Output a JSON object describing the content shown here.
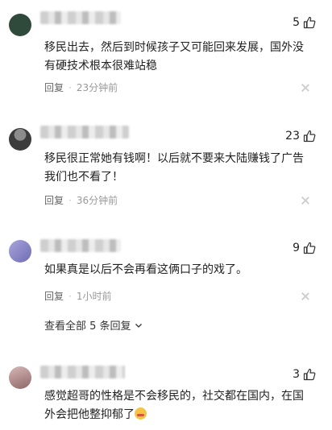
{
  "comments": [
    {
      "likes": "5",
      "text": "移民出去，然后到时候孩子又可能回来发展，国外没有硬技术根本很难站稳",
      "reply_label": "回复",
      "time": "23分钟前",
      "avatar_color": "#2f4a3a"
    },
    {
      "likes": "23",
      "text": "移民很正常她有钱啊！以后就不要来大陆赚钱了广告我们也不看了！",
      "reply_label": "回复",
      "time": "36分钟前",
      "avatar_color": "#4a4a4a"
    },
    {
      "likes": "9",
      "text": "如果真是以后不会再看这俩口子的戏了。",
      "reply_label": "回复",
      "time": "1小时前",
      "avatar_color": "#8a86c7",
      "view_all": "查看全部 5 条回复"
    },
    {
      "likes": "3",
      "text_main": "感觉超哥的性格是不会移民的，社交都在国内，在国外会把他整抑郁了",
      "emoji_icon": "crying-laughing-emoji",
      "avatar_color": "#b58a8a"
    }
  ],
  "icons": {
    "like": "thumbs-up-icon",
    "close": "close-icon",
    "chevron": "chevron-down-icon"
  }
}
